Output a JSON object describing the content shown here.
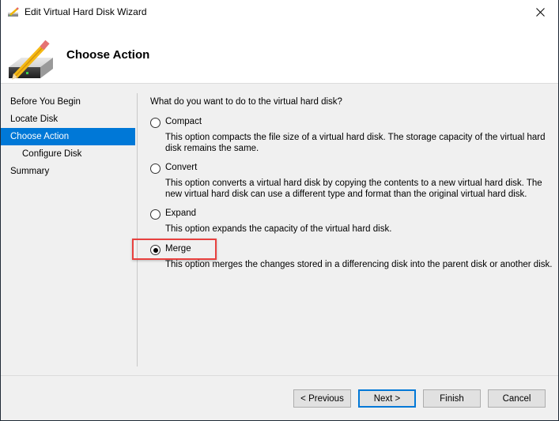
{
  "window": {
    "title": "Edit Virtual Hard Disk Wizard",
    "icon": "disk-pencil-icon",
    "close_icon": "close-icon"
  },
  "header": {
    "title": "Choose Action",
    "icon": "disk-pencil-icon"
  },
  "nav": {
    "items": [
      {
        "label": "Before You Begin",
        "active": false,
        "indent": false
      },
      {
        "label": "Locate Disk",
        "active": false,
        "indent": false
      },
      {
        "label": "Choose Action",
        "active": true,
        "indent": false
      },
      {
        "label": "Configure Disk",
        "active": false,
        "indent": true
      },
      {
        "label": "Summary",
        "active": false,
        "indent": false
      }
    ]
  },
  "content": {
    "question": "What do you want to do to the virtual hard disk?",
    "options": [
      {
        "label": "Compact",
        "checked": false,
        "description": "This option compacts the file size of a virtual hard disk. The storage capacity of the virtual hard disk remains the same."
      },
      {
        "label": "Convert",
        "checked": false,
        "description": "This option converts a virtual hard disk by copying the contents to a new virtual hard disk. The new virtual hard disk can use a different type and format than the original virtual hard disk."
      },
      {
        "label": "Expand",
        "checked": false,
        "description": "This option expands the capacity of the virtual hard disk."
      },
      {
        "label": "Merge",
        "checked": true,
        "description": "This option merges the changes stored in a differencing disk into the parent disk or another disk."
      }
    ],
    "highlight_color": "#e8413f"
  },
  "buttons": {
    "previous": "< Previous",
    "next": "Next >",
    "finish": "Finish",
    "cancel": "Cancel"
  },
  "colors": {
    "accent": "#0078d7"
  }
}
